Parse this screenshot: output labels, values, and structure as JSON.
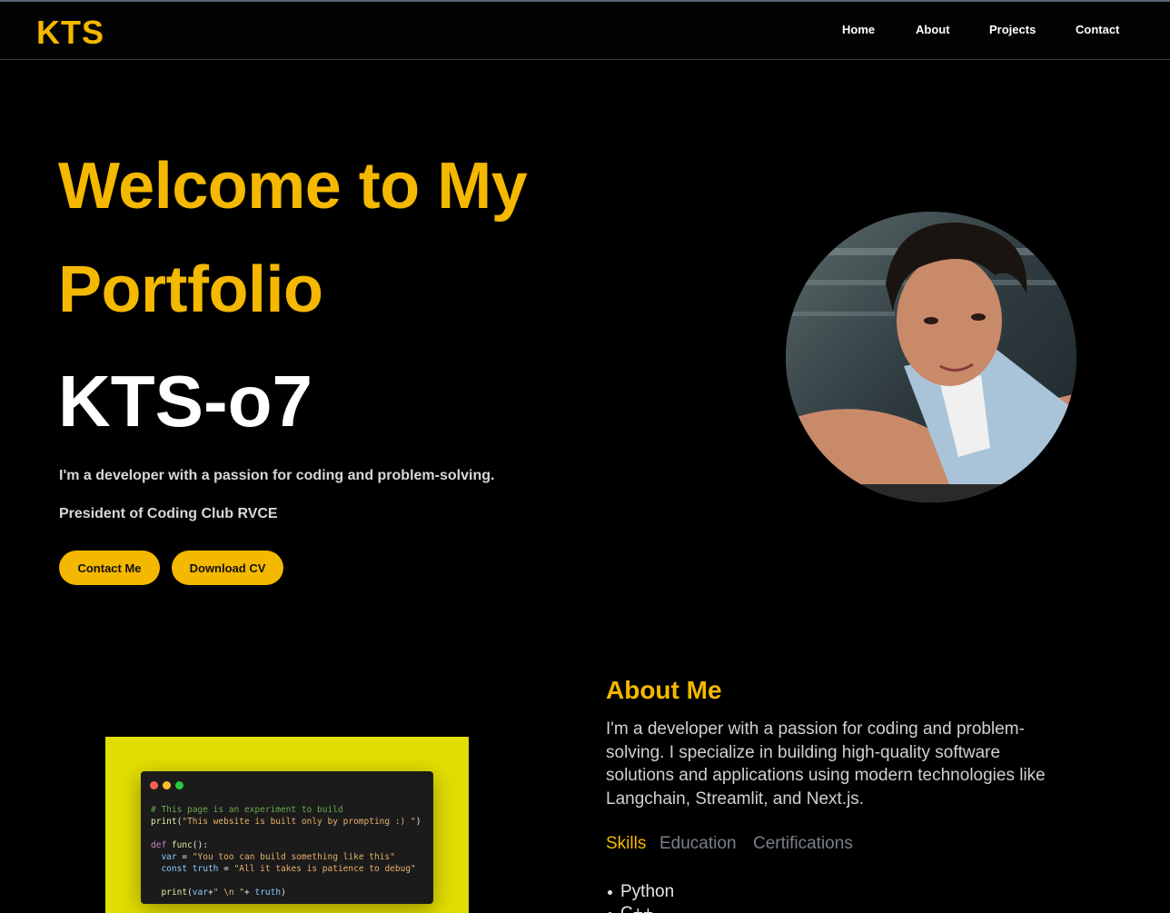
{
  "nav": {
    "logo": "KTS",
    "links": [
      "Home",
      "About",
      "Projects",
      "Contact"
    ]
  },
  "hero": {
    "title": "Welcome to My Portfolio",
    "name": "KTS-o7",
    "tagline": "I'm a developer with a passion for coding and problem-solving.",
    "role": "President of Coding Club RVCE",
    "buttons": {
      "contact": "Contact Me",
      "cv": "Download CV"
    }
  },
  "code_card": {
    "dots": [
      "#ff5f56",
      "#ffbd2e",
      "#27c93f"
    ],
    "comment": "# This page is an experiment to build",
    "print_fn": "print",
    "print_str": "\"This website is built only by prompting :) \"",
    "def_kw": "def",
    "func_name": "func",
    "var_kw": "var",
    "var_str": "\"You too can build something like this\"",
    "const_kw": "const",
    "truth_name": "truth",
    "truth_str": "\"All it takes is patience to debug\"",
    "final_print": "print",
    "final_var": "var",
    "newline_str": "\" \\n \"",
    "final_truth": "truth"
  },
  "about": {
    "title": "About Me",
    "text": "I'm a developer with a passion for coding and problem-solving. I specialize in building high-quality software solutions and applications using modern technologies like Langchain, Streamlit, and Next.js.",
    "tabs": [
      "Skills",
      "Education",
      "Certifications"
    ],
    "active_tab": "Skills",
    "skills": [
      "Python",
      "C++"
    ]
  },
  "colors": {
    "accent": "#f5b800",
    "background": "#000000",
    "code_background": "#e2dd00"
  }
}
